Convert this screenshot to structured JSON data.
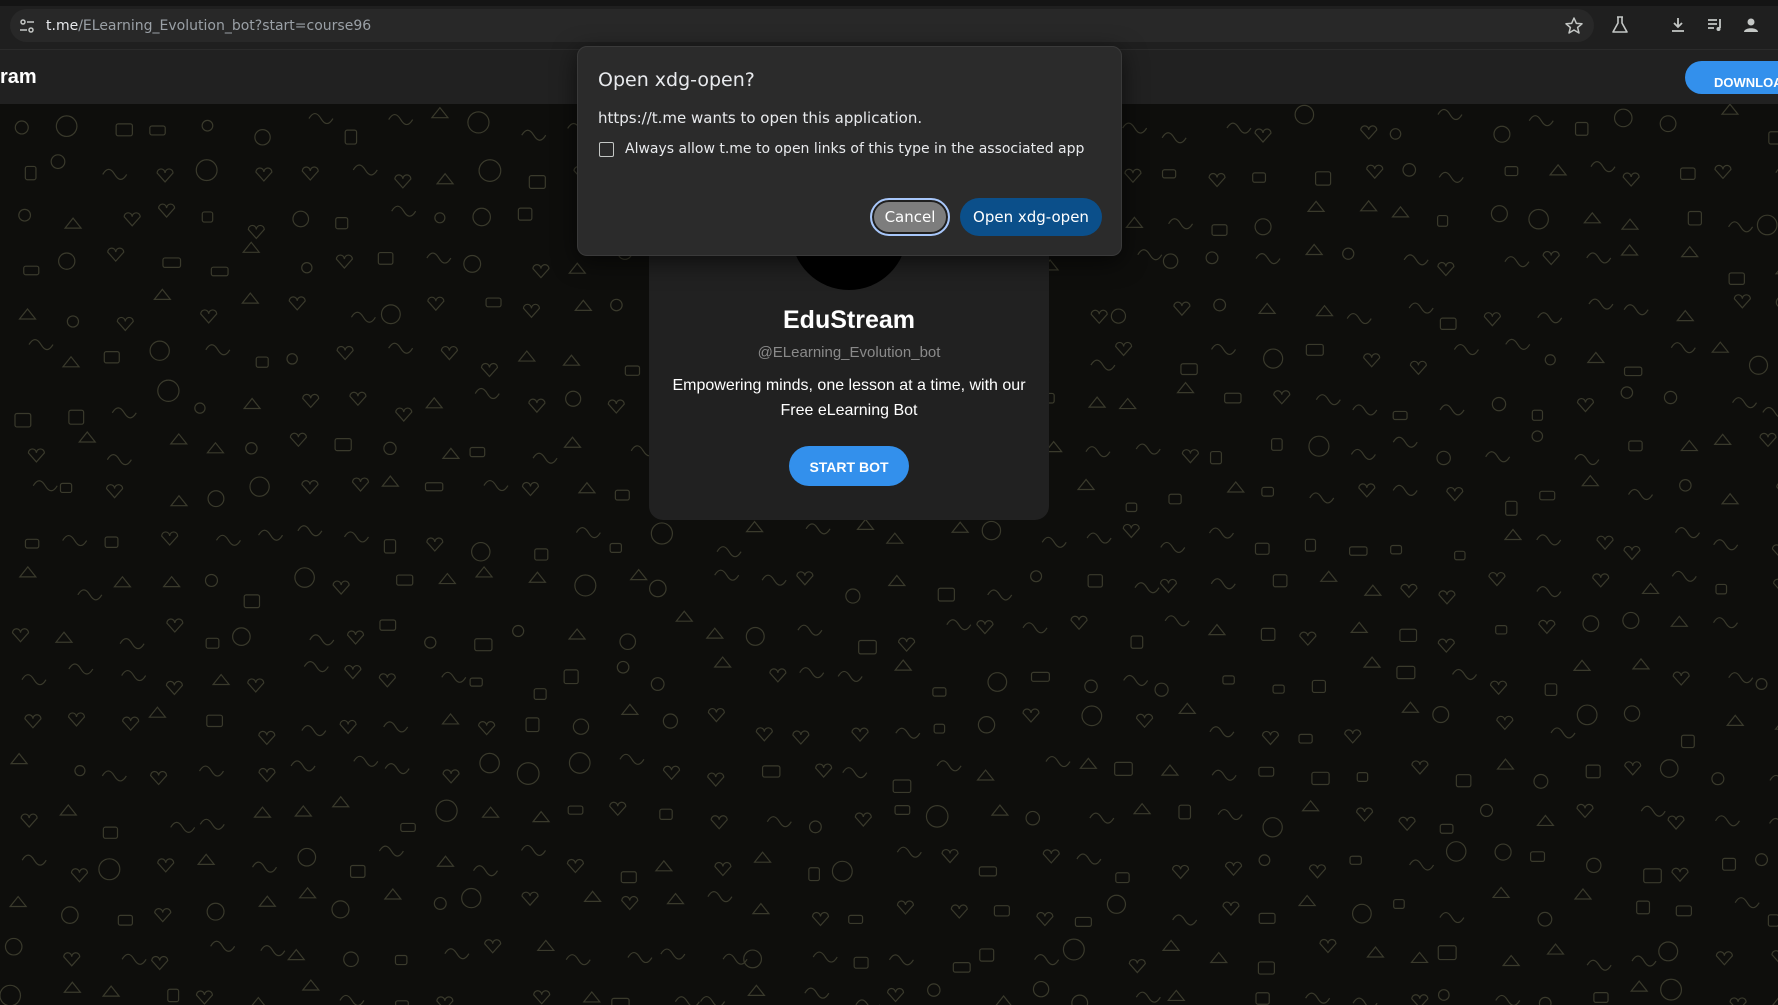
{
  "browser": {
    "url_host": "t.me",
    "url_path": "/ELearning_Evolution_bot?start=course96",
    "icons": [
      "site-info-icon",
      "bookmark-star-icon",
      "labs-flask-icon",
      "download-icon",
      "media-control-icon",
      "profile-icon"
    ]
  },
  "header": {
    "title": "ram",
    "download_label": "DOWNLOAD"
  },
  "bot": {
    "name": "EduStream",
    "username": "@ELearning_Evolution_bot",
    "description": "Empowering minds, one lesson at a time, with our Free eLearning Bot",
    "start_label": "START BOT"
  },
  "dialog": {
    "title": "Open xdg-open?",
    "message": "https://t.me wants to open this application.",
    "checkbox_label": "Always allow t.me to open links of this type in the associated app",
    "checkbox_checked": false,
    "cancel_label": "Cancel",
    "open_label": "Open xdg-open"
  },
  "colors": {
    "accent": "#3390ec",
    "dialog_primary": "#0b4f8a",
    "card": "#212121"
  }
}
